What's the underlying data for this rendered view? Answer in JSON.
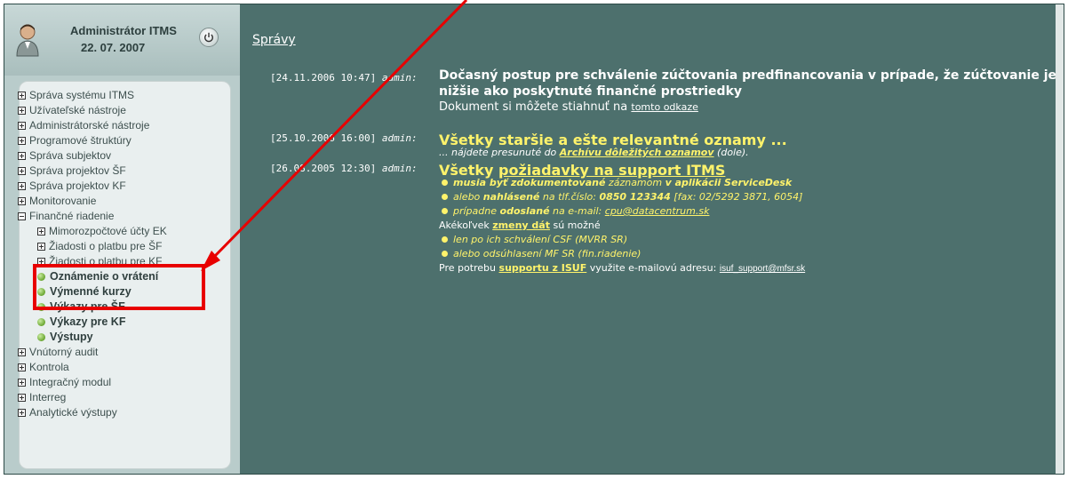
{
  "user": {
    "name": "Administrátor ITMS",
    "date": "22. 07. 2007"
  },
  "menu": {
    "items": [
      {
        "label": "Správa systému ITMS",
        "type": "plus"
      },
      {
        "label": "Užívateľské nástroje",
        "type": "plus"
      },
      {
        "label": "Administrátorské nástroje",
        "type": "plus"
      },
      {
        "label": "Programové štruktúry",
        "type": "plus"
      },
      {
        "label": "Správa subjektov",
        "type": "plus"
      },
      {
        "label": "Správa projektov ŠF",
        "type": "plus"
      },
      {
        "label": "Správa projektov KF",
        "type": "plus"
      },
      {
        "label": "Monitorovanie",
        "type": "plus"
      },
      {
        "label": "Finančné riadenie",
        "type": "minus"
      },
      {
        "label": "Mimorozpočtové účty EK",
        "type": "plus"
      },
      {
        "label": "Žiadosti o platbu pre ŠF",
        "type": "plus"
      },
      {
        "label": "Žiadosti o platbu pre KF",
        "type": "plus"
      },
      {
        "label": "Oznámenie o vrátení",
        "type": "bullet"
      },
      {
        "label": "Výmenné kurzy",
        "type": "bullet"
      },
      {
        "label": "Výkazy pre ŠF",
        "type": "bullet"
      },
      {
        "label": "Výkazy pre KF",
        "type": "bullet"
      },
      {
        "label": "Výstupy",
        "type": "bullet"
      },
      {
        "label": "Vnútorný audit",
        "type": "plus"
      },
      {
        "label": "Kontrola",
        "type": "plus"
      },
      {
        "label": "Integračný modul",
        "type": "plus"
      },
      {
        "label": "Interreg",
        "type": "plus"
      },
      {
        "label": "Analytické výstupy",
        "type": "plus"
      }
    ]
  },
  "main": {
    "title": "Správy",
    "news": [
      {
        "timestamp": "[24.11.2006 10:47]",
        "author": "admin:",
        "headline_1": "Dočasný postup pre schválenie zúčtovania predfinancovania v prípade, že zúčtovanie je",
        "headline_2": "nižšie ako poskytnuté finančné prostriedky",
        "text": "Dokument si môžete stiahnuť na ",
        "link": "tomto odkaze"
      },
      {
        "timestamp": "[25.10.2006 16:00]",
        "author": "admin:",
        "headline": "Všetky staršie a ešte relevantné oznamy ...",
        "line_a": "... nájdete presunuté do ",
        "line_link": "Archívu dôležitých oznamov",
        "line_b": " (dole)."
      },
      {
        "timestamp": "[26.08.2005 12:30]",
        "author": "admin:",
        "h_a": "Všetky ",
        "h_link": "požiadavky na support ITMS",
        "b1_a": "musia byť zdokumentované",
        "b1_b": " záznamom ",
        "b1_c": "v aplikácii ServiceDesk",
        "b2_a": "alebo ",
        "b2_b": "nahlásené",
        "b2_c": " na tlf.číslo: ",
        "b2_d": "0850 123344",
        "b2_e": " [fax: 02/5292 3871, 6054]",
        "b3_a": "prípadne ",
        "b3_b": "odoslané",
        "b3_c": " na e-mail: ",
        "b3_d": "cpu@datacentrum.sk",
        "l4_a": "Akékoľvek ",
        "l4_link": "zmeny dát",
        "l4_b": " sú možné",
        "b5": "len po ich schválení CSF (MVRR SR)",
        "b6": "alebo odsúhlasení MF SR (fin.riadenie)",
        "l7_a": "Pre potrebu ",
        "l7_link": "supportu z ISUF",
        "l7_b": " využite e-mailovú adresu: ",
        "l7_mail": "isuf_support@mfsr.sk"
      }
    ]
  },
  "colors": {
    "panel_bg": "#4d706d",
    "highlight_text": "#fff36b",
    "annotation": "#e80000"
  }
}
